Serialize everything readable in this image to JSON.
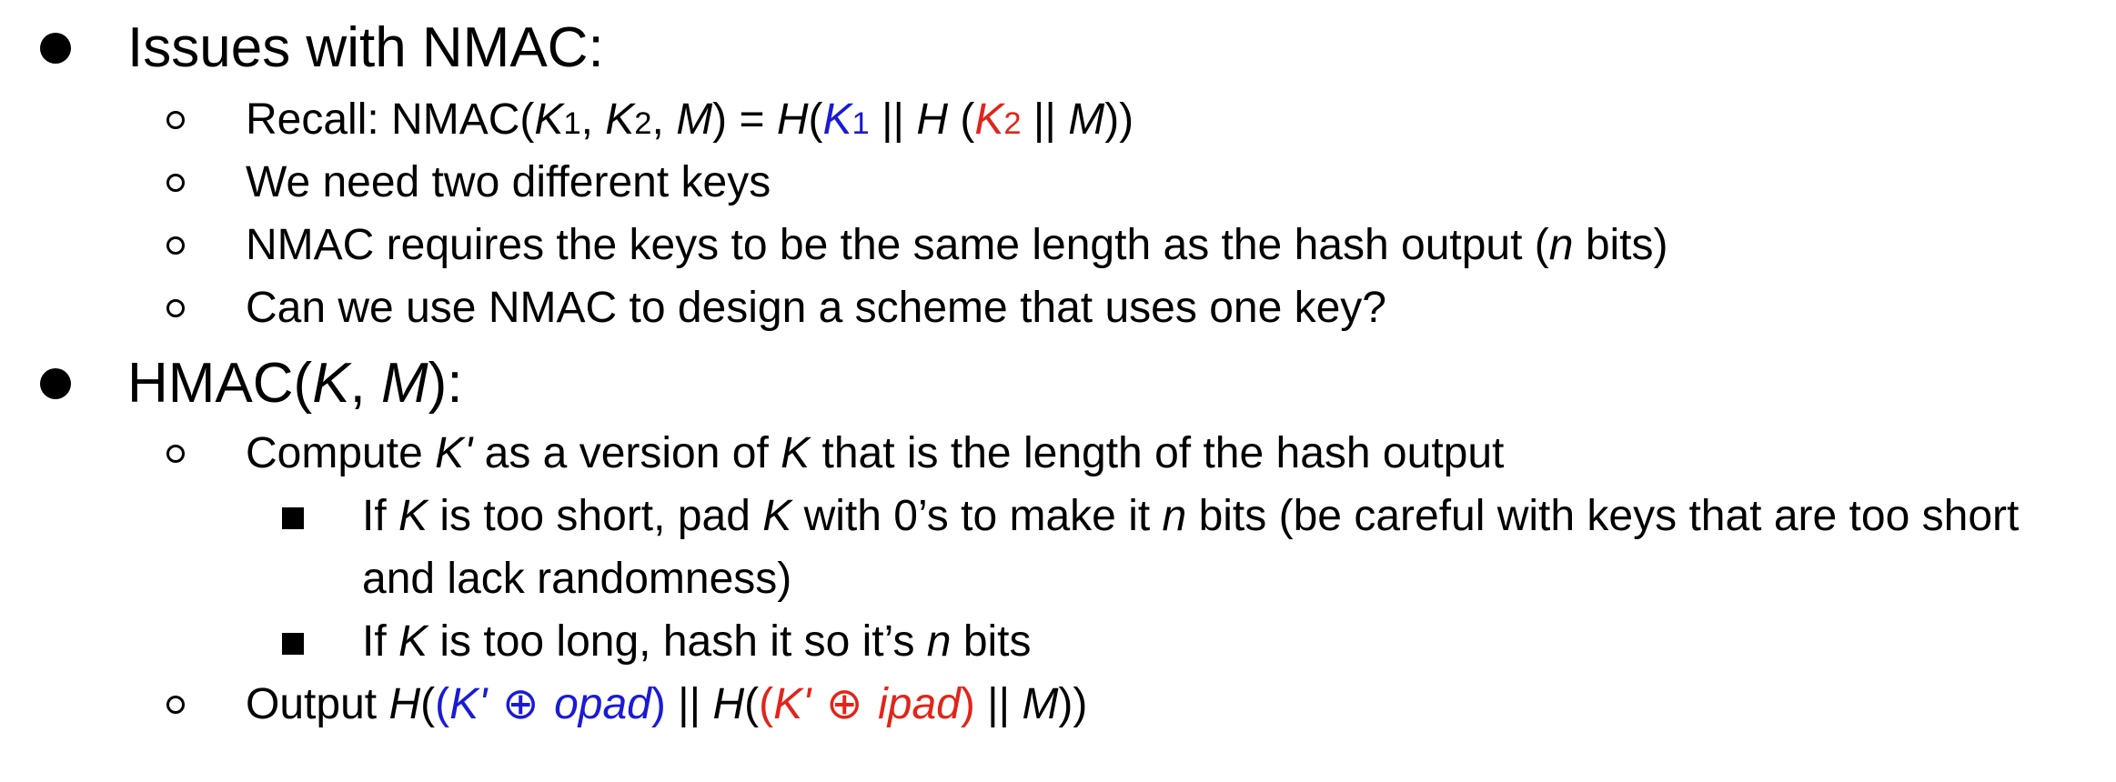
{
  "slide": {
    "bullets": [
      {
        "heading": "Issues with NMAC:",
        "sub_items": [
          {
            "recall_prefix": "Recall: NMAC(",
            "K": "K",
            "one": "1",
            "two": "2",
            "comma": ", ",
            "M": "M",
            "eq": ") = ",
            "H": "H",
            "paren_open": "(",
            "concat": " || ",
            "space_paren": " (",
            "close": "))"
          },
          {
            "text": "We need two different keys"
          },
          {
            "text_before": "NMAC requires the keys to be the same length as the hash output (",
            "n": "n",
            "text_after": " bits)"
          },
          {
            "text": "Can we use NMAC to design a scheme that uses one key?"
          }
        ]
      },
      {
        "heading_prefix": "HMAC(",
        "heading_K": "K",
        "heading_comma": ", ",
        "heading_M": "M",
        "heading_suffix": "):",
        "sub_items": [
          {
            "t1": "Compute ",
            "Kprime": "K'",
            "t2": " as a version of ",
            "K": "K",
            "t3": " that is the length of the hash output",
            "sub_sub_items": [
              {
                "t1": "If ",
                "K": "K",
                "t2": " is too short, pad ",
                "t3": " with 0’s to make it ",
                "n": "n",
                "t4": " bits (be careful with keys that are too short",
                "t5": "and lack randomness)"
              },
              {
                "t1": "If ",
                "K": "K",
                "t2": " is too long, hash it so it’s ",
                "n": "n",
                "t3": " bits"
              }
            ]
          },
          {
            "t1": "Output ",
            "H": "H",
            "open2": "((",
            "Kprime": "K'",
            "xor": "⊕",
            "opad": "opad",
            "close1": ")",
            "concat": " || ",
            "ipad": "ipad",
            "M": "M",
            "close2": "))"
          }
        ]
      }
    ],
    "colors": {
      "blue": "#1a1ad6",
      "red": "#e1251b"
    }
  }
}
